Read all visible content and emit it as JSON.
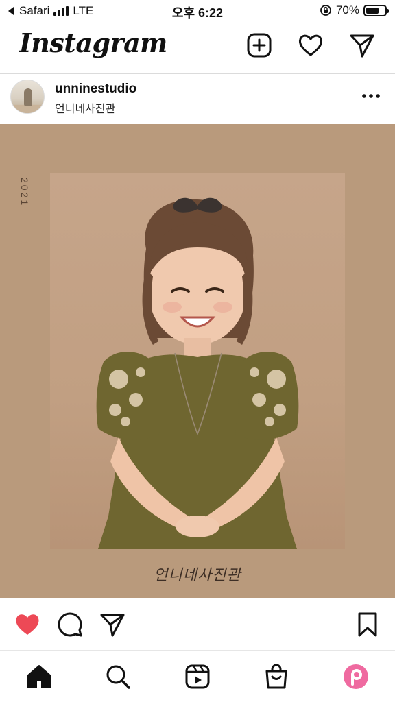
{
  "status_bar": {
    "back_app": "Safari",
    "network": "LTE",
    "time": "오후 6:22",
    "battery_percent": "70%",
    "battery_level": 0.7
  },
  "app": {
    "logo": "Instagram",
    "icons": [
      "new-post-icon",
      "heart-icon",
      "direct-message-icon"
    ]
  },
  "post": {
    "username": "unninestudio",
    "location": "언니네사진관",
    "image": {
      "year_text": "2021",
      "brand_script": "언니네사진관",
      "background_color": "#b99a7c"
    }
  },
  "actions": {
    "liked": true,
    "like_color": "#ed4956",
    "icons": [
      "like-icon",
      "comment-icon",
      "share-icon",
      "save-icon"
    ]
  },
  "bottom_nav": {
    "items": [
      "home-icon",
      "search-icon",
      "reels-icon",
      "shop-icon",
      "profile-icon"
    ],
    "profile_color": "#ef6aa0"
  }
}
